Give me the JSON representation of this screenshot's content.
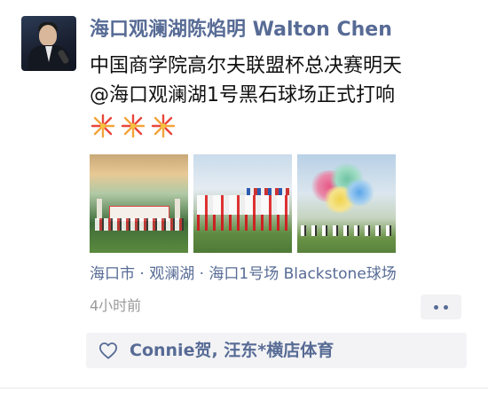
{
  "post": {
    "author": "海口观澜湖陈焰明 Walton Chen",
    "text_lines": [
      "中国商学院高尔夫联盟杯总决赛明天",
      "@海口观澜湖1号黑石球场正式打响"
    ],
    "emoji": [
      "🎆",
      "🎆",
      "🎆"
    ],
    "location": "海口市 · 观澜湖 · 海口1号场 Blackstone球场",
    "timestamp": "4小时前",
    "likes": "Connie贺, 汪东*横店体育"
  },
  "icons": {
    "avatar": "user-avatar",
    "firework": "firework-emoji",
    "more": "more-dots-icon",
    "like": "heart-outline-icon"
  },
  "colors": {
    "link": "#576b95",
    "text": "#111111",
    "muted": "#9a9a9a",
    "likes_bg": "#f3f3f5"
  }
}
